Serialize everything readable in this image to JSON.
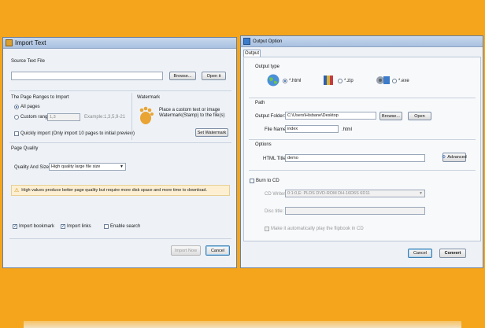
{
  "import_dialog": {
    "title": "Import Text",
    "source_label": "Source Text File",
    "source_value": "",
    "browse": "Browse...",
    "open_it": "Open it",
    "ranges_label": "The Page Ranges to Import",
    "all_pages": "All pages",
    "custom_range": "Custom range:",
    "range_value": "1,3",
    "range_example": "Example:1,3,5,9-21",
    "quickly_import": "Quickly import (Only import 10 pages to  initial  preview)",
    "watermark_label": "Watermark",
    "watermark_desc": "Place a custom text or image Watermark(Stamp) to the file(s)",
    "set_watermark": "Set Watermark",
    "page_quality_label": "Page Quality",
    "quality_size_label": "Quality And Size:",
    "quality_value": "High quality large file size",
    "warning": "High values produce better page quality but require more disk space and more time to download.",
    "import_bookmark": "Import bookmark",
    "import_links": "Import links",
    "enable_search": "Enable search",
    "import_now": "Import Now",
    "cancel": "Cancel"
  },
  "output_dialog": {
    "title": "Output Option",
    "tab": "Output",
    "output_type_label": "Output type",
    "types": [
      "*.html",
      "*.zip",
      "*.exe"
    ],
    "path_label": "Path",
    "output_folder_label": "Output Folder:",
    "output_folder_value": "C:\\Users\\Hisbane\\Desktop",
    "browse": "Browse...",
    "open": "Open",
    "file_name_label": "File Name:",
    "file_name_value": "index",
    "file_ext": ".html",
    "options_label": "Options",
    "html_title_label": "HTML Title:",
    "html_title_value": "demo",
    "advanced": "Advanced",
    "burn_cd_label": "Burn to CD",
    "cd_writer_label": "CD Writer:",
    "cd_writer_value": "0:1:0,E: PLDS     DVD-ROM DH-16D6S 6D11",
    "disc_title_label": "Disc title:",
    "disc_title_value": "",
    "autoplay": "Make it automatically play the flipbook in CD",
    "cancel": "Cancel",
    "convert": "Convert"
  },
  "colors": {
    "background": "#f4a51c",
    "window": "#eef2f7",
    "titlebar": "#b7cce8"
  }
}
